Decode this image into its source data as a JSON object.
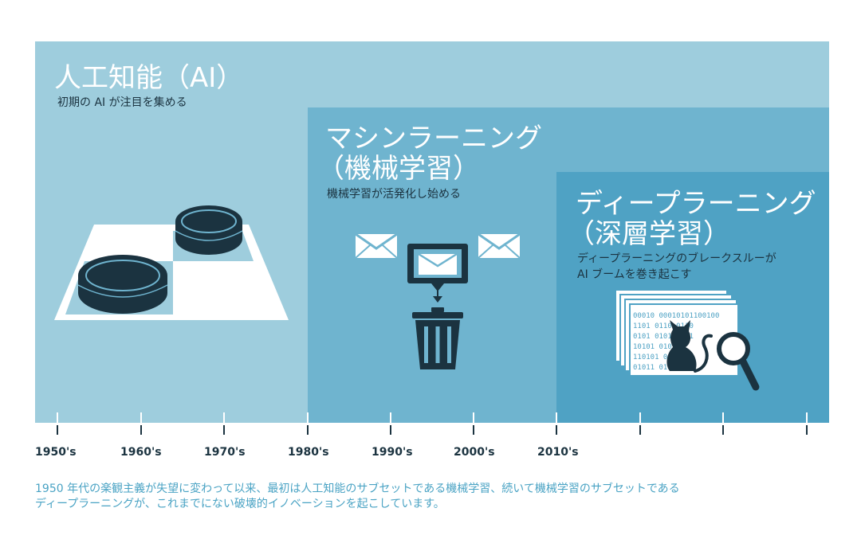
{
  "panels": {
    "ai": {
      "title": "人工知能（AI）",
      "subtitle": "初期の AI が注目を集める"
    },
    "ml": {
      "title_line1": "マシンラーニング",
      "title_line2": "（機械学習）",
      "subtitle": "機械学習が活発化し始める"
    },
    "dl": {
      "title_line1": "ディープラーニング",
      "title_line2": "（深層学習）",
      "subtitle_line1": "ディープラーニングのブレークスルーが",
      "subtitle_line2": "AI ブームを巻き起こす"
    }
  },
  "binary_text": [
    "00010 00010101100100",
    "1101 0110 0110",
    "0101 0101 0111",
    "10101 010101",
    "110101 0100101",
    "01011 010101"
  ],
  "timeline": {
    "labels": [
      "1950's",
      "1960's",
      "1970's",
      "1980's",
      "1990's",
      "2000's",
      "2010's"
    ]
  },
  "caption": {
    "line1": "1950 年代の楽観主義が失望に変わって以来、最初は人工知能のサブセットである機械学習、続いて機械学習のサブセットである",
    "line2": "ディープラーニングが、これまでにない破壊的イノベーションを起こしています。"
  },
  "colors": {
    "ai_panel": "#9ecddd",
    "ml_panel": "#6fb4cf",
    "dl_panel": "#4fa2c4",
    "dark": "#1b3340",
    "caption": "#4aa3c4"
  },
  "icons": [
    "checkers-board-icon",
    "envelope-icon",
    "trash-can-icon",
    "data-sheets-icon",
    "cat-icon",
    "magnifier-icon"
  ]
}
